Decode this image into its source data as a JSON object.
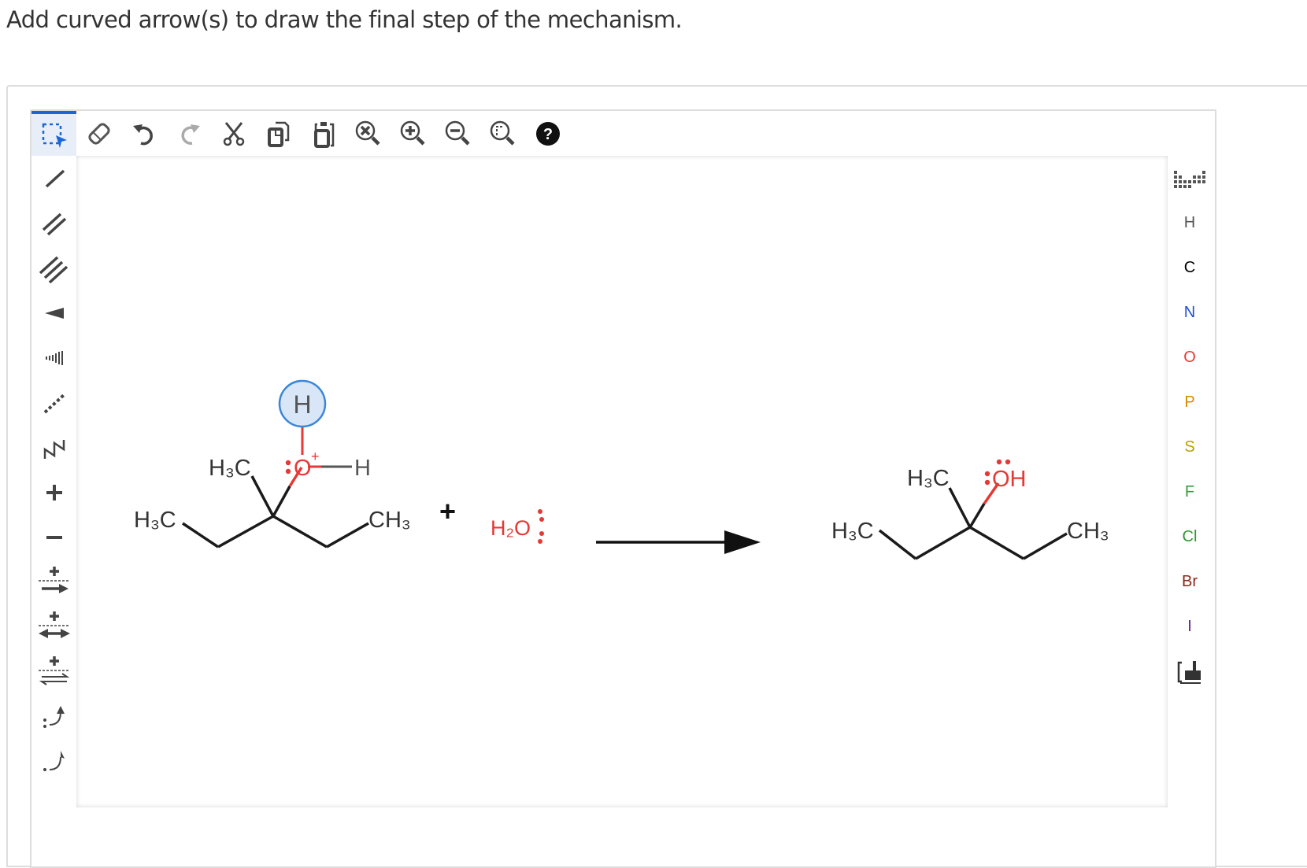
{
  "prompt": "Add curved arrow(s) to draw the final step of the mechanism.",
  "toolbar_top": {
    "tools": [
      {
        "name": "select-tool",
        "icon": "marquee-select-icon",
        "active": true
      },
      {
        "name": "erase-tool",
        "icon": "eraser-icon"
      },
      {
        "name": "undo-tool",
        "icon": "undo-icon"
      },
      {
        "name": "redo-tool",
        "icon": "redo-icon",
        "disabled": true
      },
      {
        "name": "cut-tool",
        "icon": "scissors-icon"
      },
      {
        "name": "copy-tool",
        "icon": "copy-icon"
      },
      {
        "name": "paste-tool",
        "icon": "paste-icon"
      },
      {
        "name": "zoom-reset-tool",
        "icon": "zoom-reset-icon"
      },
      {
        "name": "zoom-in-tool",
        "icon": "zoom-in-icon"
      },
      {
        "name": "zoom-out-tool",
        "icon": "zoom-out-icon"
      },
      {
        "name": "zoom-fit-tool",
        "icon": "zoom-fit-icon"
      },
      {
        "name": "help-tool",
        "icon": "help-icon"
      }
    ]
  },
  "toolbar_left": {
    "tools": [
      "single-bond",
      "double-bond",
      "triple-bond",
      "wedge-bond",
      "hash-bond",
      "dashed-bond",
      "chain",
      "positive-charge",
      "negative-charge",
      "reaction-arrow",
      "resonance-arrow",
      "equilibrium-arrow",
      "electron-pair-arrow",
      "single-electron-arrow"
    ]
  },
  "toolbar_right": {
    "periodic_table_icon": "periodic-table-icon",
    "elements": [
      {
        "symbol": "H",
        "color": "#555555"
      },
      {
        "symbol": "C",
        "color": "#000000"
      },
      {
        "symbol": "N",
        "color": "#1f4fd8"
      },
      {
        "symbol": "O",
        "color": "#e53935"
      },
      {
        "symbol": "P",
        "color": "#d98a00"
      },
      {
        "symbol": "S",
        "color": "#b8a000"
      },
      {
        "symbol": "F",
        "color": "#3a9a3a"
      },
      {
        "symbol": "Cl",
        "color": "#2e9a2e"
      },
      {
        "symbol": "Br",
        "color": "#8b2a1a"
      },
      {
        "symbol": "I",
        "color": "#6a1b9a"
      }
    ],
    "template_icon": "template-icon"
  },
  "scheme": {
    "reactant": {
      "methyl_top": "H₃C",
      "methyl_left": "H₃C",
      "methyl_right": "CH₃",
      "oxonium_O": "O",
      "oxonium_charge": "+",
      "oxonium_H_right": "H",
      "highlighted_H": "H"
    },
    "plus": "+",
    "water": "H₂O",
    "product": {
      "methyl_top": "H₃C",
      "methyl_left": "H₃C",
      "methyl_right": "CH₃",
      "hydroxyl": "OH"
    },
    "colors": {
      "oxygen": "#e53935",
      "highlight_stroke": "#3a87d8",
      "highlight_fill": "#d8e6f7",
      "bond": "#1a1a1a",
      "accent": "#1a66d9"
    }
  }
}
